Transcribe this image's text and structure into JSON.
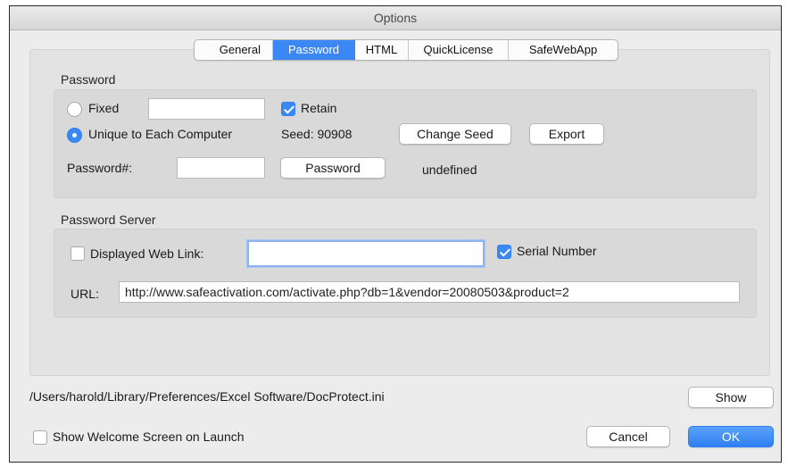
{
  "window": {
    "title": "Options"
  },
  "tabs": [
    {
      "label": "General",
      "active": false
    },
    {
      "label": "Password",
      "active": true
    },
    {
      "label": "HTML",
      "active": false
    },
    {
      "label": "QuickLicense",
      "active": false
    },
    {
      "label": "SafeWebApp",
      "active": false
    }
  ],
  "password_section": {
    "heading": "Password",
    "fixed_label": "Fixed",
    "fixed_value": "",
    "retain_label": "Retain",
    "unique_label": "Unique to Each Computer",
    "seed_text": "Seed: 90908",
    "change_seed_label": "Change Seed",
    "export_label": "Export",
    "password_number_label": "Password#:",
    "password_number_value": "",
    "password_button_label": "Password",
    "result_text": "undefined"
  },
  "server_section": {
    "heading": "Password Server",
    "web_link_label": "Displayed Web Link:",
    "web_link_value": "",
    "serial_label": "Serial Number",
    "url_label": "URL:",
    "url_value": "http://www.safeactivation.com/activate.php?db=1&vendor=20080503&product=2"
  },
  "footer": {
    "ini_path": "/Users/harold/Library/Preferences/Excel Software/DocProtect.ini",
    "show_label": "Show",
    "welcome_label": "Show Welcome Screen on Launch",
    "cancel_label": "Cancel",
    "ok_label": "OK"
  },
  "colors": {
    "accent": "#3b88f5"
  }
}
